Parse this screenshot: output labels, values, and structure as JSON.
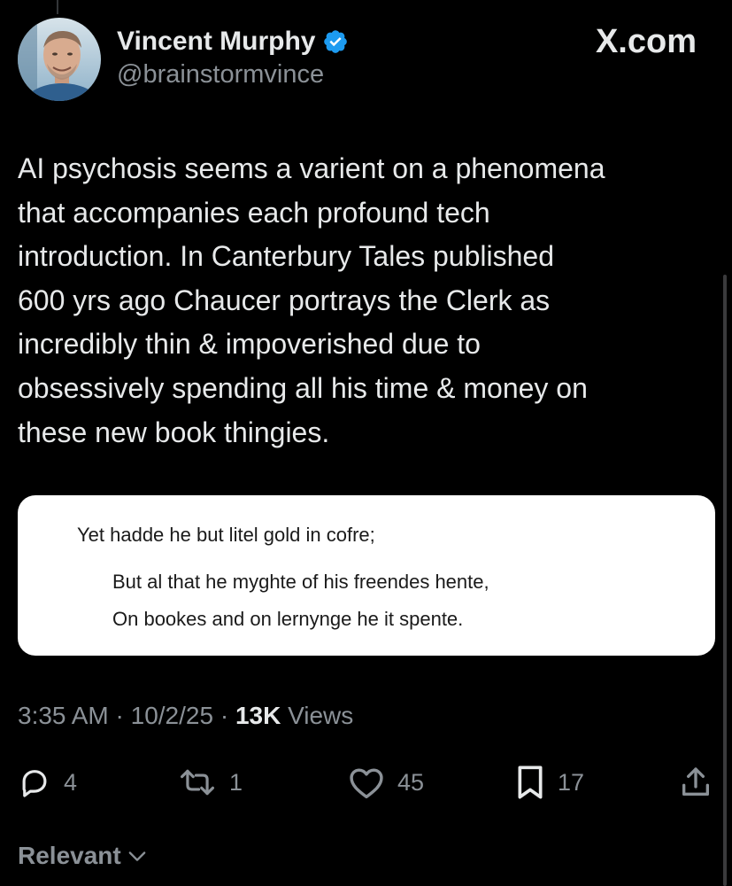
{
  "tweet": {
    "author": {
      "display_name": "Vincent Murphy",
      "handle": "@brainstormvince",
      "verified": true
    },
    "brand": "X.com",
    "text": "AI psychosis seems a varient on a phenomena\nthat accompanies each profound tech\nintroduction. In Canterbury Tales published\n600 yrs ago Chaucer portrays the Clerk as\nincredibly thin & impoverished due to\nobsessively spending all his time & money on\nthese new book thingies.",
    "quote_image": {
      "lines": [
        "Yet hadde he but litel gold in cofre;",
        "But al that he myghte of his freendes hente,",
        "On bookes and on lernynge he it spente."
      ]
    },
    "meta": {
      "time": "3:35 AM",
      "separator": "·",
      "date": "10/2/25",
      "views_count": "13K",
      "views_label": "Views"
    },
    "actions": {
      "reply": {
        "icon": "reply-icon",
        "count": "4"
      },
      "repost": {
        "icon": "repost-icon",
        "count": "1"
      },
      "like": {
        "icon": "heart-icon",
        "count": "45"
      },
      "bookmark": {
        "icon": "bookmark-icon",
        "count": "17"
      },
      "share": {
        "icon": "share-icon"
      }
    }
  },
  "replies_sort": {
    "label": "Relevant",
    "icon": "chevron-down-icon"
  },
  "colors": {
    "background": "#000000",
    "text_primary": "#e7e9ea",
    "text_secondary": "#8b9197",
    "verified_blue": "#1d9bf0",
    "card_background": "#ffffff"
  }
}
